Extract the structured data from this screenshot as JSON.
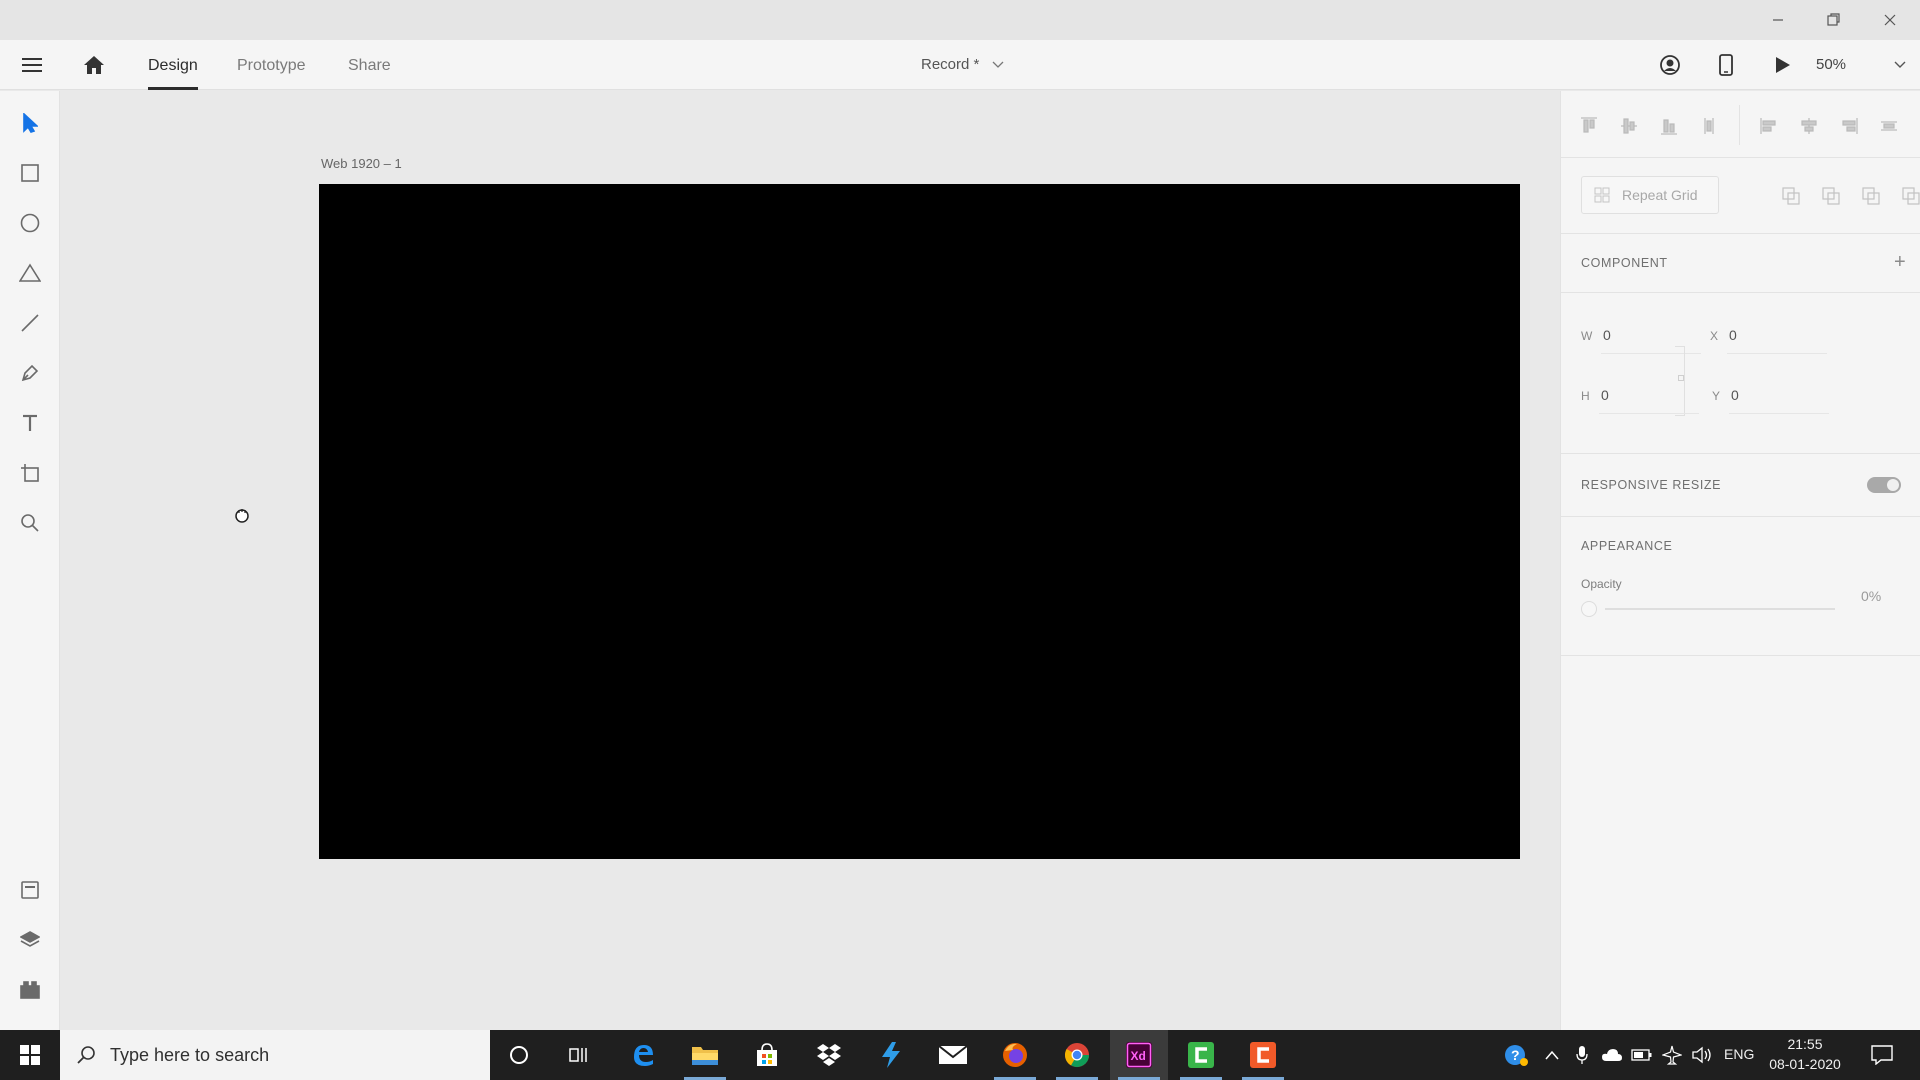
{
  "window": {
    "controls": [
      "minimize",
      "restore",
      "close"
    ]
  },
  "topbar": {
    "tabs": [
      {
        "label": "Design",
        "active": true
      },
      {
        "label": "Prototype",
        "active": false
      },
      {
        "label": "Share",
        "active": false
      }
    ],
    "document_title": "Record *",
    "zoom": "50%"
  },
  "left_tools": [
    "select-tool",
    "rectangle-tool",
    "ellipse-tool",
    "polygon-tool",
    "line-tool",
    "pen-tool",
    "text-tool",
    "artboard-tool",
    "zoom-tool",
    "assets",
    "layers",
    "plugins"
  ],
  "canvas": {
    "artboard_label": "Web 1920 – 1",
    "artboard_color": "#000000"
  },
  "right_panel": {
    "repeat_grid_label": "Repeat Grid",
    "component_title": "COMPONENT",
    "component_add": "+",
    "transform": {
      "w_label": "W",
      "w_value": "0",
      "h_label": "H",
      "h_value": "0",
      "x_label": "X",
      "x_value": "0",
      "y_label": "Y",
      "y_value": "0"
    },
    "responsive_resize_title": "RESPONSIVE RESIZE",
    "responsive_resize_on": true,
    "appearance_title": "APPEARANCE",
    "opacity_label": "Opacity",
    "opacity_value": "0%"
  },
  "taskbar": {
    "search_placeholder": "Type here to search",
    "language": "ENG",
    "time": "21:55",
    "date": "08-01-2020"
  },
  "colors": {
    "accent_blue": "#1473e6",
    "xd_pink": "#ff61f6",
    "taskbar": "#1f1f1f"
  }
}
